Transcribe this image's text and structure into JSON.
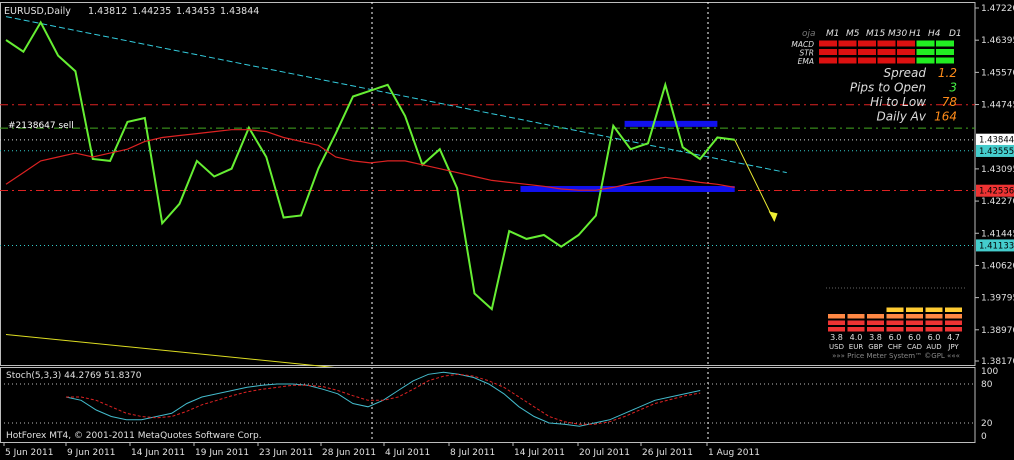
{
  "chart_data": {
    "type": "line",
    "title": "EURUSD,Daily",
    "ohlc": [
      "1.43812",
      "1.44235",
      "1.43453",
      "1.43844"
    ],
    "annotation": "#2138647 sell",
    "copyright": "HotForex MT4, © 2001-2011 MetaQuotes Software Corp.",
    "price_axis_ticks": [
      "1.47220",
      "1.46395",
      "1.45570",
      "1.44745",
      "1.43844",
      "1.43555",
      "1.43095",
      "1.42536",
      "1.42270",
      "1.41445",
      "1.41133",
      "1.40620",
      "1.39795",
      "1.38970",
      "1.38170"
    ],
    "highlighted_prices": [
      {
        "label": "1.43844",
        "bg": "#ffffff",
        "fg": "#000000"
      },
      {
        "label": "1.43555",
        "bg": "#44cccc",
        "fg": "#000000"
      },
      {
        "label": "1.42536",
        "bg": "#ee3333",
        "fg": "#000000"
      },
      {
        "label": "1.41133",
        "bg": "#44cccc",
        "fg": "#000000"
      }
    ],
    "date_labels": [
      "5 Jun 2011",
      "9 Jun 2011",
      "14 Jun 2011",
      "19 Jun 2011",
      "23 Jun 2011",
      "28 Jun 2011",
      "4 Jul 2011",
      "8 Jul 2011",
      "14 Jul 2011",
      "20 Jul 2011",
      "26 Jul 2011",
      "1 Aug 2011"
    ],
    "series": [
      {
        "name": "price",
        "color": "#66ee33",
        "values": [
          1.464,
          1.461,
          1.4685,
          1.46,
          1.456,
          1.4335,
          1.433,
          1.443,
          1.444,
          1.417,
          1.422,
          1.433,
          1.429,
          1.431,
          1.4415,
          1.434,
          1.4185,
          1.419,
          1.431,
          1.44,
          1.4495,
          1.451,
          1.4525,
          1.4445,
          1.432,
          1.436,
          1.426,
          1.399,
          1.395,
          1.415,
          1.413,
          1.414,
          1.411,
          1.414,
          1.419,
          1.442,
          1.436,
          1.4375,
          1.4525,
          1.4365,
          1.4335,
          1.439,
          1.4384
        ]
      },
      {
        "name": "moving-average",
        "color": "#dd2222",
        "values": [
          1.427,
          1.43,
          1.433,
          1.434,
          1.435,
          1.434,
          1.435,
          1.436,
          1.438,
          1.439,
          1.4395,
          1.44,
          1.4405,
          1.441,
          1.441,
          1.4405,
          1.439,
          1.438,
          1.437,
          1.434,
          1.433,
          1.4325,
          1.433,
          1.433,
          1.432,
          1.431,
          1.43,
          1.429,
          1.428,
          1.4275,
          1.427,
          1.4265,
          1.4258,
          1.4255,
          1.4255,
          1.4262,
          1.4272,
          1.428,
          1.4288,
          1.4282,
          1.4275,
          1.427,
          1.4262
        ]
      }
    ],
    "horizontal_lines": [
      {
        "price": 1.4474,
        "style": "red-dash"
      },
      {
        "price": 1.4414,
        "style": "green-dash"
      },
      {
        "price": 1.4384,
        "style": "white-dot"
      },
      {
        "price": 1.4356,
        "style": "cyan-dot"
      },
      {
        "price": 1.4254,
        "style": "red-dash"
      },
      {
        "price": 1.4113,
        "style": "cyan-dot"
      }
    ],
    "zones": [
      {
        "from_bar": 36,
        "to_bar": 41,
        "price": 1.4425,
        "color": "#1111ee"
      },
      {
        "from_bar": 30,
        "to_bar": 42,
        "price": 1.4258,
        "color": "#1111ee"
      }
    ],
    "trendlines": [
      {
        "from": [
          0,
          1.47
        ],
        "to": [
          45,
          1.43
        ],
        "color": "#33ccdd"
      },
      {
        "from": [
          0,
          1.3885
        ],
        "to": [
          19,
          1.38
        ],
        "color": "#dddd22"
      },
      {
        "from": [
          42,
          1.4384
        ],
        "to": [
          44.3,
          1.4175
        ],
        "color": "#eeee33"
      }
    ],
    "info_panel": {
      "header": [
        "oja",
        "M1",
        "M5",
        "M15",
        "M30",
        "H1",
        "H4",
        "D1"
      ],
      "rows": [
        {
          "name": "MACD",
          "cells": [
            "red",
            "red",
            "red",
            "red",
            "red",
            "green",
            "green"
          ]
        },
        {
          "name": "STR",
          "cells": [
            "red",
            "red",
            "red",
            "red",
            "red",
            "green",
            "green"
          ]
        },
        {
          "name": "EMA",
          "cells": [
            "red",
            "red",
            "red",
            "red",
            "red",
            "green",
            "green"
          ]
        }
      ],
      "stats": [
        {
          "label": "Spread",
          "value": "1.2",
          "color": "#ff8c1a"
        },
        {
          "label": "Pips to Open",
          "value": "3",
          "color": "#44ee44"
        },
        {
          "label": "Hi to Low",
          "value": "78",
          "color": "#ff8c1a"
        },
        {
          "label": "Daily Av",
          "value": "164",
          "color": "#ff8c1a"
        }
      ]
    },
    "price_meter": {
      "values": [
        "3.8",
        "4.0",
        "3.8",
        "6.0",
        "6.0",
        "6.0",
        "4.7"
      ],
      "currencies": [
        "USD",
        "EUR",
        "GBP",
        "CHF",
        "CAD",
        "AUD",
        "JPY"
      ],
      "footer": "»»» Price Meter System™ ©GPL «««"
    },
    "stochastic": {
      "title": "Stoch(5,3,3) 44.2769 51.8370",
      "levels": [
        "100",
        "80",
        "20",
        "0"
      ],
      "main": [
        60,
        55,
        40,
        30,
        25,
        25,
        30,
        35,
        50,
        60,
        65,
        70,
        75,
        78,
        80,
        80,
        78,
        72,
        65,
        50,
        45,
        55,
        70,
        85,
        95,
        98,
        95,
        90,
        80,
        65,
        45,
        30,
        20,
        18,
        15,
        20,
        25,
        35,
        45,
        55,
        60,
        65,
        70
      ],
      "signal": [
        60,
        60,
        55,
        45,
        35,
        30,
        28,
        30,
        38,
        48,
        55,
        62,
        68,
        72,
        75,
        78,
        78,
        76,
        70,
        62,
        55,
        55,
        60,
        72,
        85,
        92,
        95,
        92,
        85,
        75,
        60,
        45,
        30,
        22,
        18,
        18,
        22,
        30,
        40,
        50,
        56,
        62,
        66
      ]
    }
  }
}
